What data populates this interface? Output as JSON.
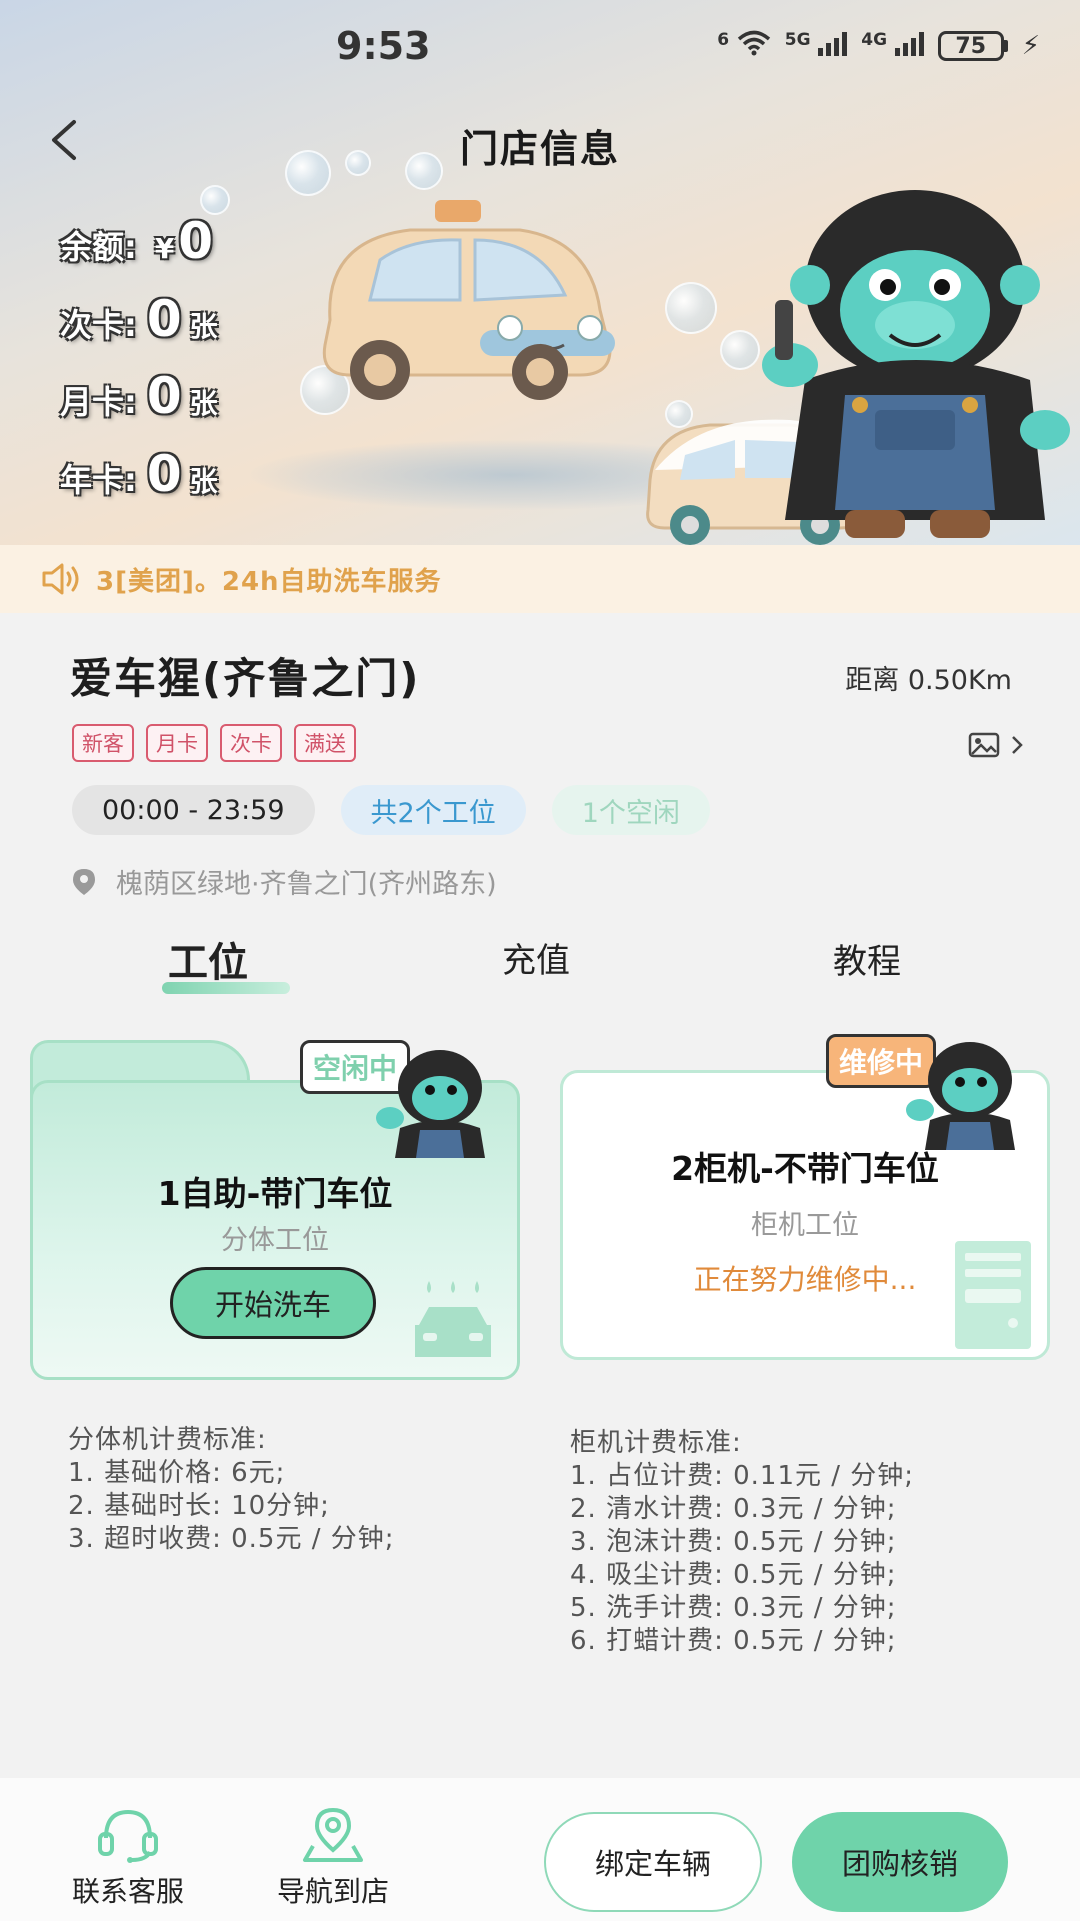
{
  "status_bar": {
    "time": "9:53",
    "wifi_label": "6",
    "net_5g": "5G",
    "net_4g": "4G",
    "battery": "75"
  },
  "header": {
    "title": "门店信息"
  },
  "account": {
    "balance_label": "余额:",
    "balance_currency": "¥",
    "balance_value": "0",
    "count_card_label": "次卡:",
    "count_card_value": "0",
    "month_card_label": "月卡:",
    "month_card_value": "0",
    "year_card_label": "年卡:",
    "year_card_value": "0",
    "unit": "张"
  },
  "notice": {
    "text": "3[美团]。24h自助洗车服务"
  },
  "store": {
    "name": "爱车猩(齐鲁之门)",
    "distance": "距离 0.50Km",
    "tags": [
      "新客",
      "月卡",
      "次卡",
      "满送"
    ],
    "hours": "00:00 - 23:59",
    "slots_total": "共2个工位",
    "slots_free": "1个空闲",
    "address": "槐荫区绿地·齐鲁之门(齐州路东)"
  },
  "tabs": [
    "工位",
    "充值",
    "教程"
  ],
  "stations": [
    {
      "badge": "空闲中",
      "title": "1自助-带门车位",
      "type": "分体工位",
      "action": "开始洗车"
    },
    {
      "badge": "维修中",
      "title": "2柜机-不带门车位",
      "type": "柜机工位",
      "status": "正在努力维修中..."
    }
  ],
  "pricing_left": {
    "title": "分体机计费标准:",
    "lines": [
      "1. 基础价格: 6元;",
      "2. 基础时长: 10分钟;",
      "3. 超时收费: 0.5元 / 分钟;"
    ]
  },
  "pricing_right": {
    "title": "柜机计费标准:",
    "lines": [
      "1. 占位计费: 0.11元 / 分钟;",
      "2. 清水计费: 0.3元 / 分钟;",
      "3. 泡沫计费: 0.5元 / 分钟;",
      "4. 吸尘计费: 0.5元 / 分钟;",
      "5. 洗手计费: 0.3元 / 分钟;",
      "6. 打蜡计费: 0.5元 / 分钟;"
    ]
  },
  "bottom_bar": {
    "service_label": "联系客服",
    "navigate_label": "导航到店",
    "bind_label": "绑定车辆",
    "group_label": "团购核销"
  },
  "colors": {
    "accent": "#6fd3aa",
    "tag": "#d05268",
    "notice": "#e0a24c",
    "repair": "#e08a3a",
    "slots": "#3a98cf"
  },
  "icons": [
    "back-arrow-icon",
    "speaker-icon",
    "image-icon",
    "chevron-right-icon",
    "location-pin-icon",
    "headset-icon",
    "navigation-pin-icon",
    "wifi-icon",
    "bolt-icon"
  ]
}
